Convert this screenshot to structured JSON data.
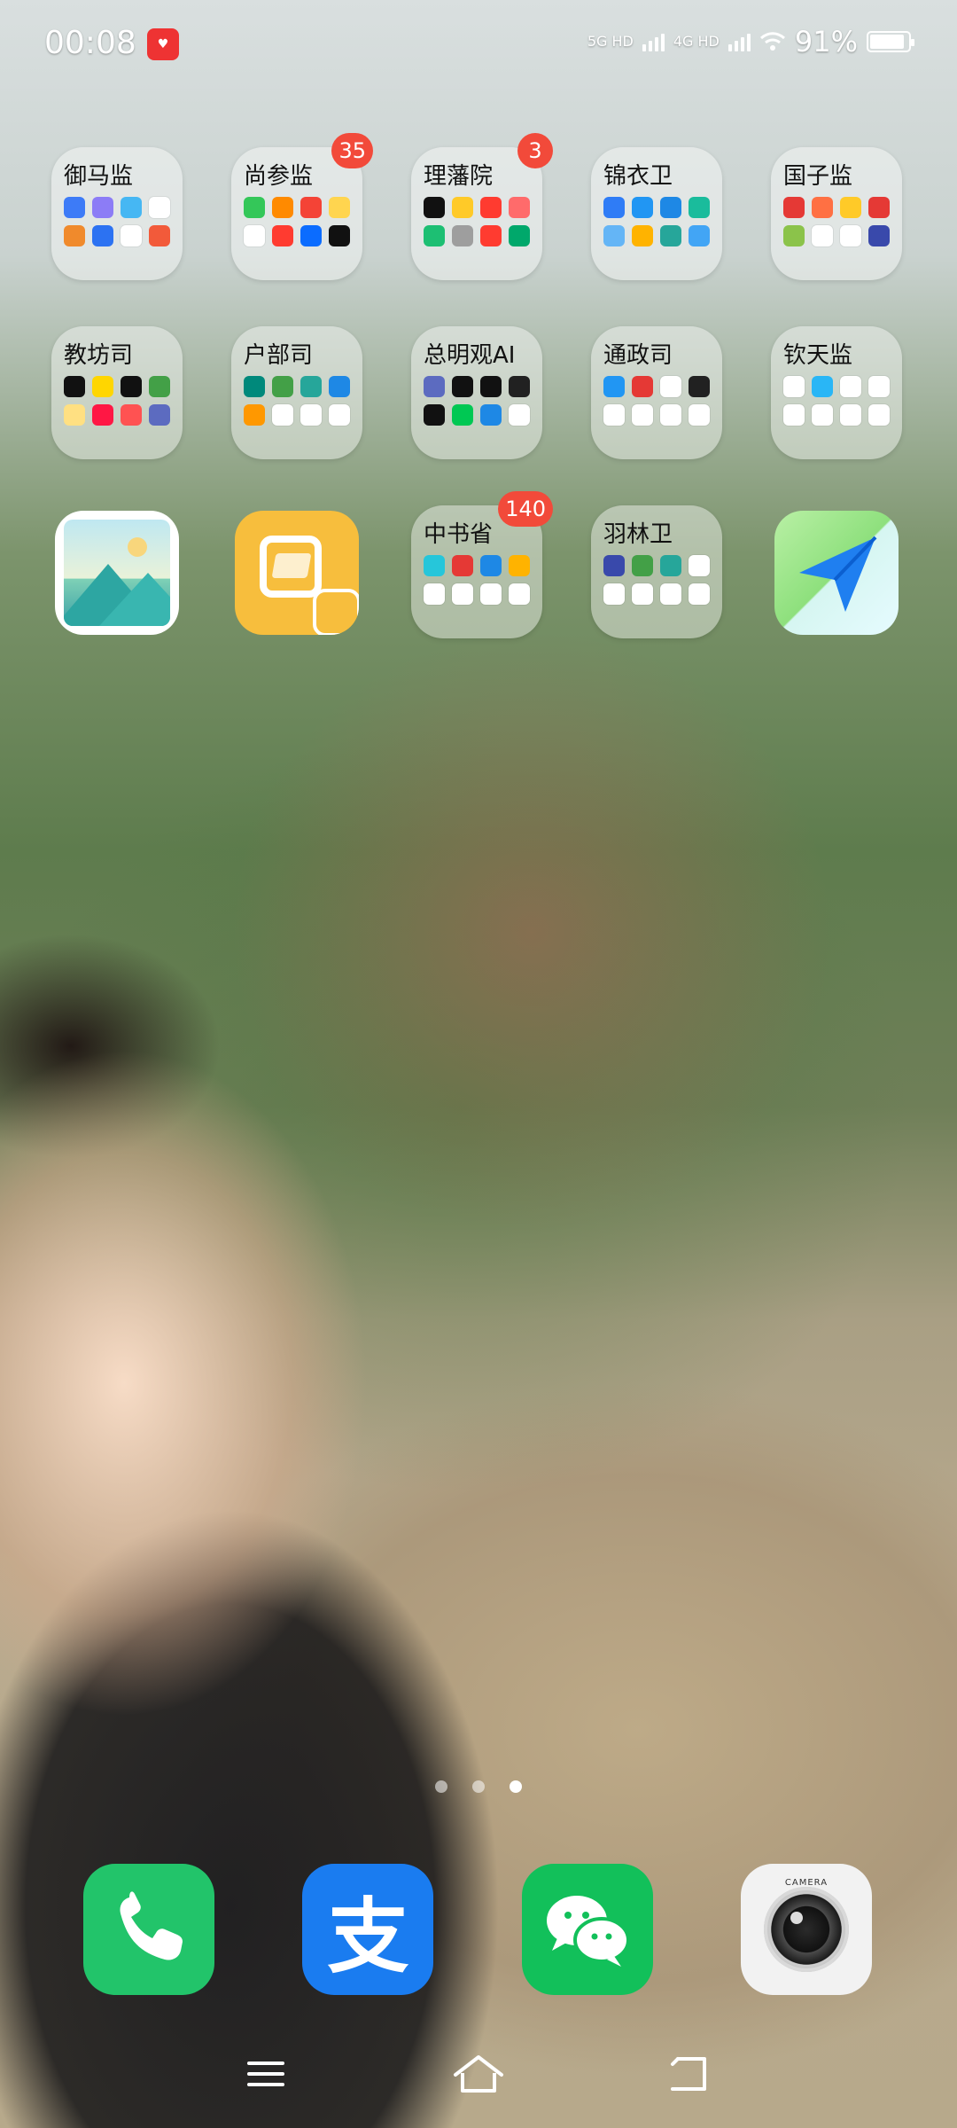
{
  "status_bar": {
    "time": "00:08",
    "network_1": "5G HD",
    "network_2": "4G HD",
    "battery_percent": "91%",
    "battery_level": 0.91
  },
  "grid": [
    {
      "type": "folder",
      "name": "御马监",
      "icon_colors": [
        "#3d7bf7",
        "#8c7cf6",
        "#46b7f3",
        "#ffffff",
        "#f08a2c",
        "#2c72f2",
        "#ffffff",
        "#f25a3a"
      ]
    },
    {
      "type": "folder",
      "name": "尚参监",
      "badge": "35",
      "icon_colors": [
        "#34c759",
        "#ff8a00",
        "#f44336",
        "#ffd54f",
        "#ffffff",
        "#ff3b30",
        "#0b6cff",
        "#111111"
      ]
    },
    {
      "type": "folder",
      "name": "理藩院",
      "badge": "3",
      "icon_colors": [
        "#111111",
        "#ffca28",
        "#ff3b30",
        "#ff6b6b",
        "#1dbf73",
        "#9e9e9e",
        "#ff3b30",
        "#00a86b"
      ]
    },
    {
      "type": "folder",
      "name": "锦衣卫",
      "icon_colors": [
        "#2f7cf6",
        "#2196f3",
        "#1e88e5",
        "#1abc9c",
        "#64b5f6",
        "#ffb300",
        "#26a69a",
        "#42a5f5"
      ]
    },
    {
      "type": "folder",
      "name": "国子监",
      "icon_colors": [
        "#e53935",
        "#ff7043",
        "#ffca28",
        "#e53935",
        "#8bc34a",
        "#ffffff",
        "#ffffff",
        "#3949ab"
      ]
    },
    {
      "type": "folder",
      "name": "教坊司",
      "icon_colors": [
        "#111111",
        "#ffd600",
        "#111111",
        "#43a047",
        "#ffe082",
        "#ff1744",
        "#ff5252",
        "#5c6bc0"
      ]
    },
    {
      "type": "folder",
      "name": "户部司",
      "icon_colors": [
        "#00897b",
        "#43a047",
        "#26a69a",
        "#1e88e5",
        "#ff9800",
        "#ffffff",
        "#ffffff",
        "#ffffff"
      ]
    },
    {
      "type": "folder",
      "name": "总明观AI",
      "icon_colors": [
        "#5c6bc0",
        "#111111",
        "#111111",
        "#212121",
        "#111111",
        "#00c853",
        "#1e88e5",
        "#ffffff"
      ]
    },
    {
      "type": "folder",
      "name": "通政司",
      "icon_colors": [
        "#2196f3",
        "#e53935",
        "#ffffff",
        "#212121",
        "#ffffff",
        "#ffffff",
        "#ffffff",
        "#ffffff"
      ]
    },
    {
      "type": "folder",
      "name": "钦天监",
      "icon_colors": [
        "#ffffff",
        "#29b6f6",
        "#ffffff",
        "#ffffff",
        "#ffffff",
        "#ffffff",
        "#ffffff",
        "#ffffff"
      ]
    },
    {
      "type": "app",
      "app": "gallery-icon"
    },
    {
      "type": "app",
      "app": "scanner-icon"
    },
    {
      "type": "folder",
      "name": "中书省",
      "badge": "140",
      "icon_colors": [
        "#26c6da",
        "#e53935",
        "#1e88e5",
        "#ffb300",
        "#ffffff",
        "#ffffff",
        "#ffffff",
        "#ffffff"
      ]
    },
    {
      "type": "folder",
      "name": "羽林卫",
      "icon_colors": [
        "#3949ab",
        "#43a047",
        "#26a69a",
        "#ffffff",
        "#ffffff",
        "#ffffff",
        "#ffffff",
        "#ffffff"
      ]
    },
    {
      "type": "app",
      "app": "maps-icon"
    }
  ],
  "page_indicator": {
    "count": 3,
    "active_index": 2
  },
  "dock": [
    {
      "app": "phone-icon"
    },
    {
      "app": "alipay-icon",
      "glyph": "支"
    },
    {
      "app": "wechat-icon"
    },
    {
      "app": "camera-icon",
      "label": "CAMERA"
    }
  ]
}
